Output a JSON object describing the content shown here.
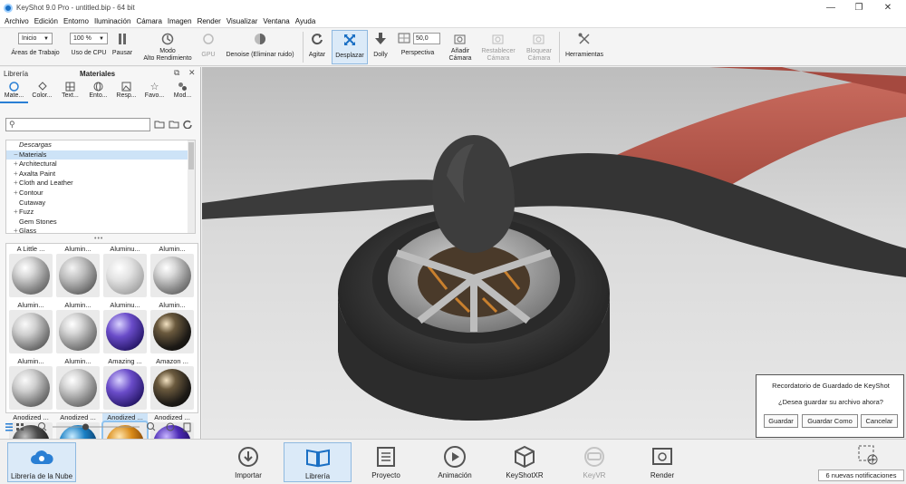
{
  "window": {
    "title": "KeyShot 9.0 Pro - untitled.bip - 64 bit",
    "minimize": "—",
    "maximize": "❐",
    "close": "✕"
  },
  "menu": [
    "Archivo",
    "Edición",
    "Entorno",
    "Iluminación",
    "Cámara",
    "Imagen",
    "Render",
    "Visualizar",
    "Ventana",
    "Ayuda"
  ],
  "toolbar": {
    "workspace_select": "Inicio",
    "workspace_label": "Áreas de Trabajo",
    "cpu_select": "100 %",
    "cpu_label": "Uso de CPU",
    "pause_label": "Pausar",
    "perf_mode_line1": "Modo",
    "perf_mode_line2": "Alto Rendimiento",
    "gpu_label": "GPU",
    "denoise_label": "Denoise (Eliminar ruido)",
    "tumble_label": "Agitar",
    "pan_label": "Desplazar",
    "dolly_label": "Dolly",
    "perspective_value": "50,0",
    "perspective_label": "Perspectiva",
    "add_camera_line1": "Añadir",
    "add_camera_line2": "Cámara",
    "reset_camera_line1": "Restablecer",
    "reset_camera_line2": "Cámara",
    "lock_camera_line1": "Bloquear",
    "lock_camera_line2": "Cámara",
    "tools_label": "Herramientas"
  },
  "library": {
    "panel_title": "Librería",
    "tab_title": "Materiales",
    "tabs": [
      "Mate...",
      "Color...",
      "Text...",
      "Ento...",
      "Resp...",
      "Favo...",
      "Mod..."
    ],
    "tree": [
      {
        "label": "Descargas",
        "expand": "",
        "italic": true,
        "selected": false
      },
      {
        "label": "Materials",
        "expand": "−",
        "italic": false,
        "selected": true
      },
      {
        "label": "Architectural",
        "expand": "+",
        "italic": false,
        "selected": false
      },
      {
        "label": "Axalta Paint",
        "expand": "+",
        "italic": false,
        "selected": false
      },
      {
        "label": "Cloth and Leather",
        "expand": "+",
        "italic": false,
        "selected": false
      },
      {
        "label": "Contour",
        "expand": "+",
        "italic": false,
        "selected": false
      },
      {
        "label": "Cutaway",
        "expand": "",
        "italic": false,
        "selected": false
      },
      {
        "label": "Fuzz",
        "expand": "+",
        "italic": false,
        "selected": false
      },
      {
        "label": "Gem Stones",
        "expand": "",
        "italic": false,
        "selected": false
      },
      {
        "label": "Glass",
        "expand": "+",
        "italic": false,
        "selected": false
      }
    ],
    "grip": "•••",
    "thumbnails": [
      {
        "label": "A Little ...",
        "style": "silver",
        "selected": false
      },
      {
        "label": "Alumin...",
        "style": "hex",
        "selected": false
      },
      {
        "label": "Aluminu...",
        "style": "hexlight",
        "selected": false
      },
      {
        "label": "Alumin...",
        "style": "silver",
        "selected": false
      },
      {
        "label": "Alumin...",
        "style": "brushed",
        "selected": false
      },
      {
        "label": "Alumin...",
        "style": "silver",
        "selected": false
      },
      {
        "label": "Aluminu...",
        "style": "purple",
        "selected": false
      },
      {
        "label": "Alumin...",
        "style": "dark",
        "selected": false
      },
      {
        "label": "Alumin...",
        "style": "brushed",
        "selected": false
      },
      {
        "label": "Alumin...",
        "style": "silver",
        "selected": false
      },
      {
        "label": "Amazing ...",
        "style": "purple",
        "selected": false
      },
      {
        "label": "Amazon ...",
        "style": "dark",
        "selected": false
      },
      {
        "label": "Anodized ...",
        "style": "black",
        "selected": false
      },
      {
        "label": "Anodized ...",
        "style": "blue",
        "selected": false
      },
      {
        "label": "Anodized ...",
        "style": "orange",
        "selected": true
      },
      {
        "label": "Anodized ...",
        "style": "violet",
        "selected": false
      }
    ],
    "slider_value": 0.38
  },
  "save_dialog": {
    "title": "Recordatorio de Guardado de KeyShot",
    "message": "¿Desea guardar su archivo ahora?",
    "save": "Guardar",
    "save_as": "Guardar Como",
    "cancel": "Cancelar"
  },
  "bottombar": {
    "cloud_library": "Librería de la Nube",
    "import": "Importar",
    "library": "Librería",
    "project": "Proyecto",
    "animation": "Animación",
    "keyshotxr": "KeyShotXR",
    "keyvr": "KeyVR",
    "render": "Render",
    "notifications": "6 nuevas notificaciones"
  },
  "colors": {
    "accent": "#2a7fd4",
    "active_bg": "#dbeaf8",
    "propeller": "#3a3a3a",
    "frame": "#b85a4f"
  }
}
